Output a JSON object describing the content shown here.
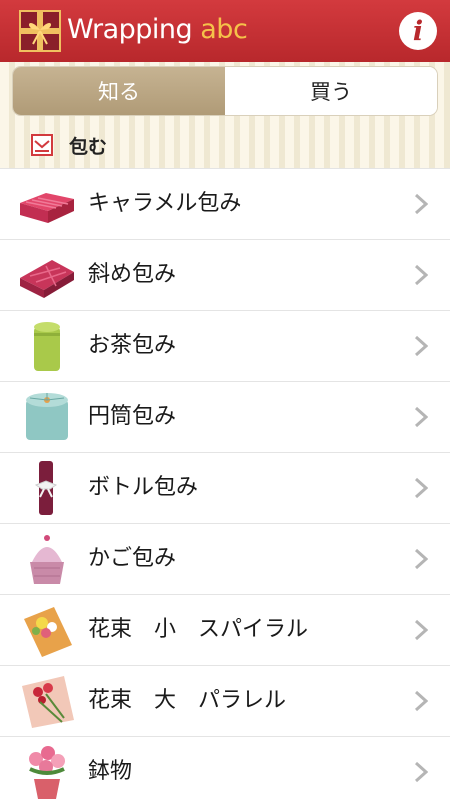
{
  "header": {
    "title_main": "Wrapping",
    "title_accent": "abc",
    "info_label": "i"
  },
  "tabs": [
    {
      "label": "知る",
      "active": true
    },
    {
      "label": "買う",
      "active": false
    }
  ],
  "section": {
    "label": "包む",
    "icon": "envelope-icon"
  },
  "items": [
    {
      "label": "キャラメル包み",
      "icon": "caramel-wrap-icon"
    },
    {
      "label": "斜め包み",
      "icon": "diagonal-wrap-icon"
    },
    {
      "label": "お茶包み",
      "icon": "tea-wrap-icon"
    },
    {
      "label": "円筒包み",
      "icon": "cylinder-wrap-icon"
    },
    {
      "label": "ボトル包み",
      "icon": "bottle-wrap-icon"
    },
    {
      "label": "かご包み",
      "icon": "basket-wrap-icon"
    },
    {
      "label": "花束　小　スパイラル",
      "icon": "small-bouquet-icon"
    },
    {
      "label": "花束　大　パラレル",
      "icon": "large-bouquet-icon"
    },
    {
      "label": "鉢物",
      "icon": "potted-plant-icon"
    }
  ],
  "colors": {
    "header_red": "#c2303a",
    "accent_gold": "#f5c24a",
    "tab_active": "#b8a37f"
  }
}
